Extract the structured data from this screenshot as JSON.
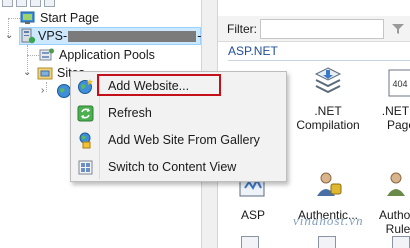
{
  "tree": {
    "start_page": "Start Page",
    "server_prefix": "VPS-",
    "server_suffix": "-",
    "application_pools": "Application Pools",
    "sites": "Sites"
  },
  "right_pane": {
    "filter_label": "Filter:",
    "section_header": "ASP.NET",
    "features": [
      {
        "line1": ".NET",
        "line2": "Compilation"
      },
      {
        "line1": ".NET E",
        "line2": "Page"
      },
      {
        "line1": "ASP",
        "line2": ""
      },
      {
        "line1": "Authentic...",
        "line2": ""
      },
      {
        "line1": "Authori",
        "line2": "Rule"
      }
    ],
    "icon_badge": "404",
    "watermark": "vinahost.vn"
  },
  "context_menu": {
    "items": [
      {
        "label": "Add Website...",
        "icon": "add-website-icon"
      },
      {
        "label": "Refresh",
        "icon": "refresh-icon"
      },
      {
        "label": "Add Web Site From Gallery",
        "icon": "gallery-icon"
      },
      {
        "label": "Switch to Content View",
        "icon": "content-view-icon"
      }
    ]
  },
  "colors": {
    "selection": "#cce8ff",
    "highlight_border": "#c4101a",
    "section_header": "#1f4e9a"
  }
}
